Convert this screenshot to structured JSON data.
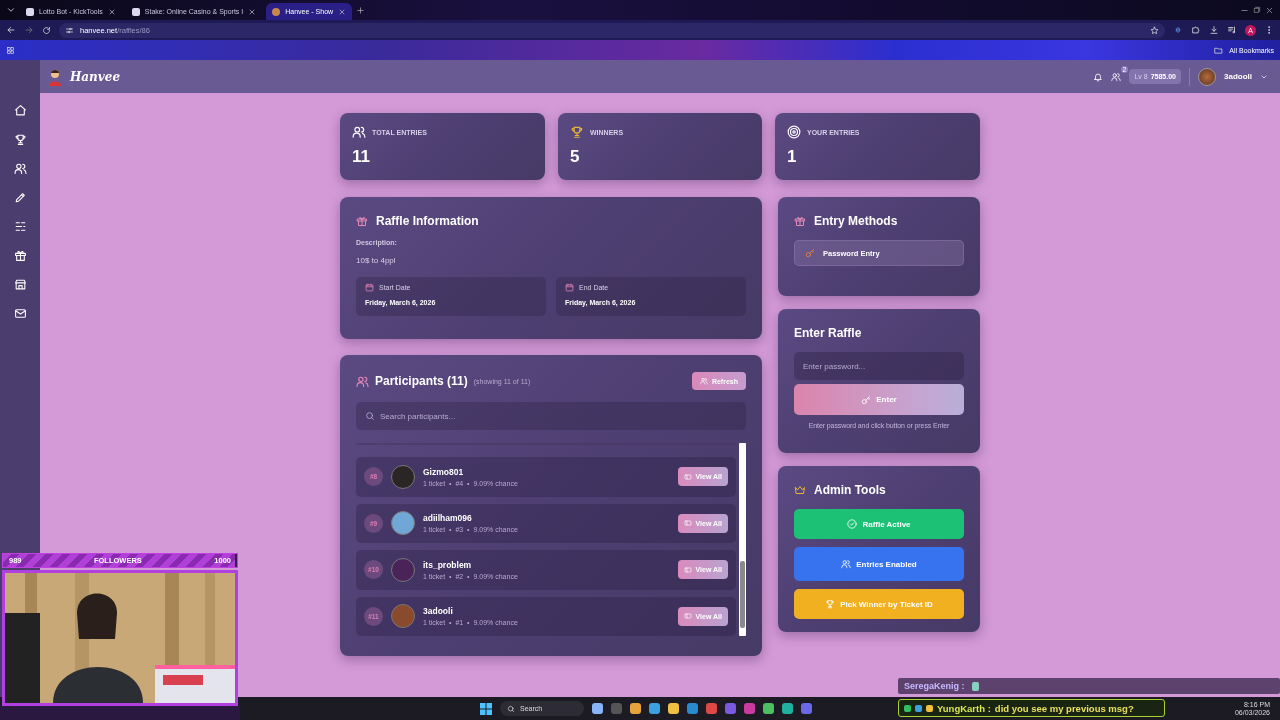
{
  "browser": {
    "tabs": [
      {
        "title": "Lotto Bot - KickTools",
        "selected": false
      },
      {
        "title": "Stake: Online Casino & Sports I",
        "selected": false
      },
      {
        "title": "Hanvee - Show",
        "selected": true
      }
    ],
    "url_host": "hanvee.net",
    "url_path": "/raffles/86",
    "bookmarks_label": "All Bookmarks",
    "profile_initial": "A"
  },
  "header": {
    "logo": "Hanvee",
    "friends_badge": "2",
    "level": "Lv 8",
    "balance": "7585.00",
    "username": "3adooli"
  },
  "stats": [
    {
      "label": "TOTAL ENTRIES",
      "value": "11"
    },
    {
      "label": "WINNERS",
      "value": "5"
    },
    {
      "label": "YOUR ENTRIES",
      "value": "1"
    }
  ],
  "raffle_info": {
    "title": "Raffle Information",
    "description_label": "Description:",
    "description": "10$ to 4ppl",
    "dates": [
      {
        "label": "Start Date",
        "value": "Friday, March 6, 2026"
      },
      {
        "label": "End Date",
        "value": "Friday, March 6, 2026"
      }
    ]
  },
  "participants": {
    "title": "Participants (11)",
    "showing": "(showing 11 of 11)",
    "refresh": "Refresh",
    "search_placeholder": "Search participants...",
    "rows": [
      {
        "rank": "#8",
        "name": "Gizmo801",
        "meta": "1 ticket  •  #4  •  9.09% chance",
        "action": "View All",
        "color": "#2b2626"
      },
      {
        "rank": "#9",
        "name": "adiilham096",
        "meta": "1 ticket  •  #3  •  9.09% chance",
        "action": "View All",
        "color": "#6fa8d6"
      },
      {
        "rank": "#10",
        "name": "its_problem",
        "meta": "1 ticket  •  #2  •  9.09% chance",
        "action": "View All",
        "color": "#4a2458"
      },
      {
        "rank": "#11",
        "name": "3adooli",
        "meta": "1 ticket  •  #1  •  9.09% chance",
        "action": "View All",
        "color": "#8a4a2e"
      }
    ]
  },
  "entry_methods": {
    "title": "Entry Methods",
    "methods": [
      "Password Entry"
    ]
  },
  "enter_raffle": {
    "title": "Enter Raffle",
    "placeholder": "Enter password...",
    "button": "Enter",
    "hint": "Enter password and click button or press Enter"
  },
  "admin_tools": {
    "title": "Admin Tools",
    "buttons": [
      {
        "label": "Raffle Active",
        "kind": "success"
      },
      {
        "label": "Entries Enabled",
        "kind": "info"
      },
      {
        "label": "Pick Winner by Ticket ID",
        "kind": "warning"
      }
    ]
  },
  "stream_overlay": {
    "current": "989",
    "followers_label": "FOLLOWERS",
    "goal": "1000",
    "level": 0.99,
    "chat": [
      {
        "user": "SeregaKenig :"
      },
      {
        "user": "YungKarth :",
        "message": "did you see my previous msg?"
      }
    ]
  },
  "taskbar": {
    "search": "Search",
    "time": "8:16 PM",
    "date": "06/03/2026"
  }
}
